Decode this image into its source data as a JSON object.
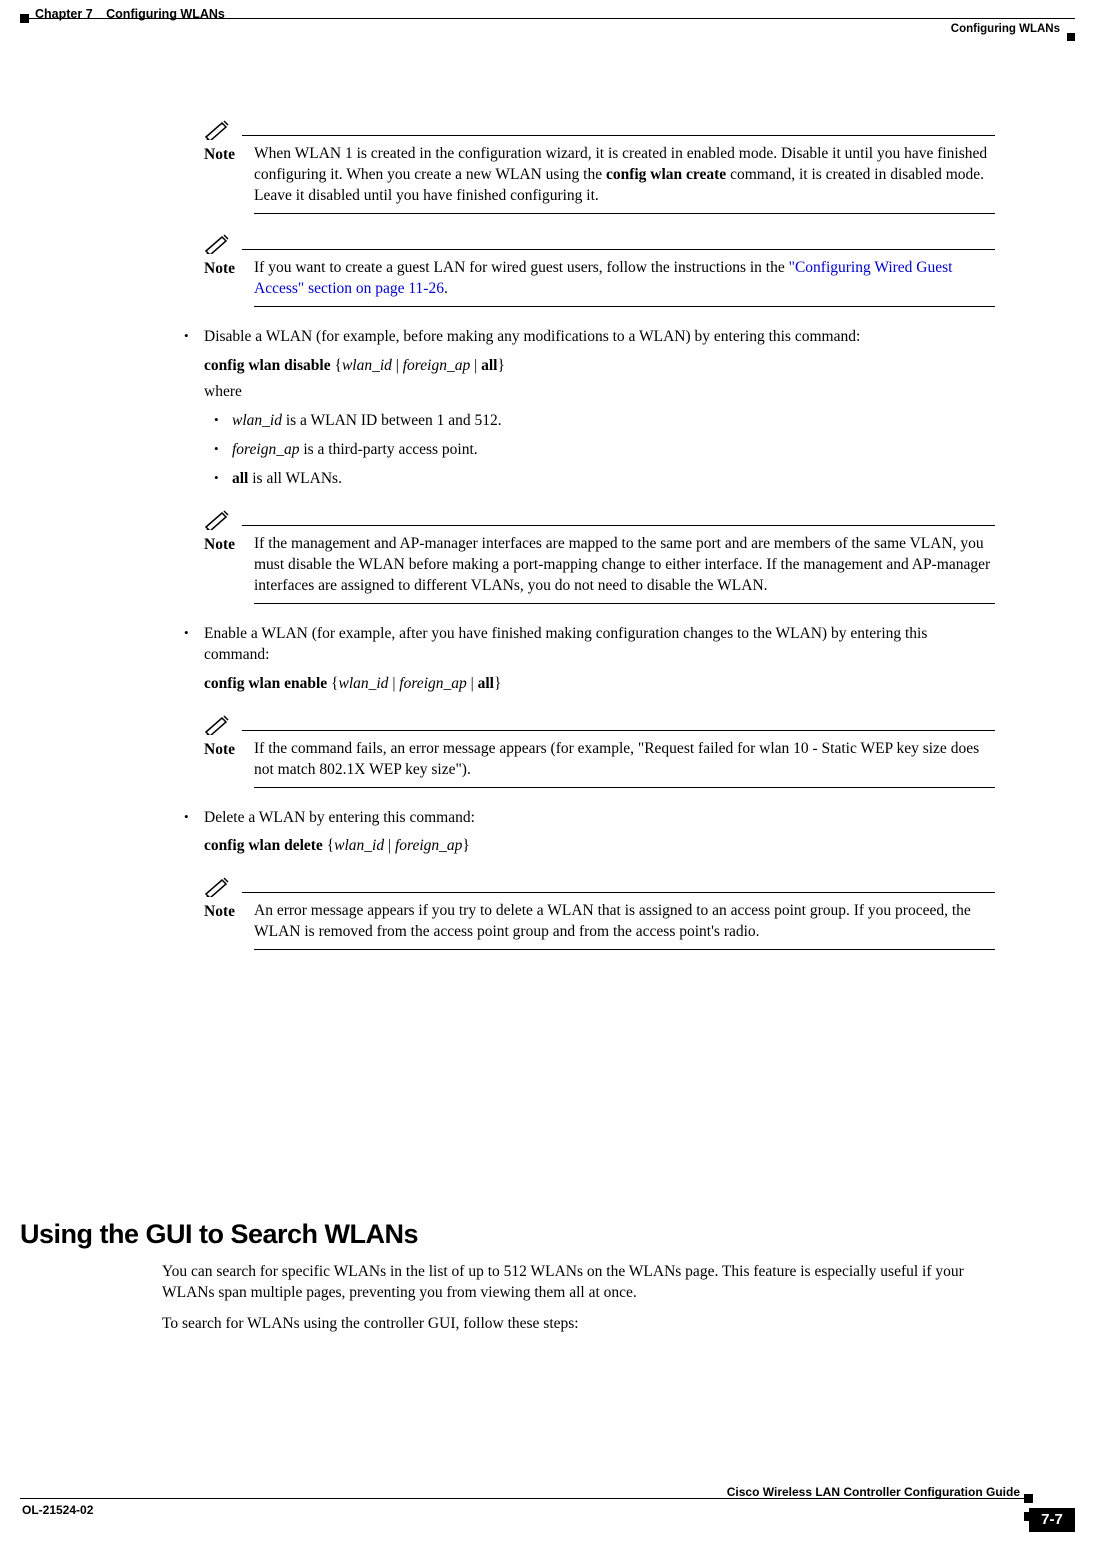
{
  "header": {
    "chapter_left": "Chapter 7",
    "chapter_title": "Configuring WLANs",
    "section_right": "Configuring WLANs"
  },
  "note_label": "Note",
  "notes": {
    "n1": "When WLAN 1 is created in the configuration wizard, it is created in enabled mode. Disable it until you have finished configuring it. When you create a new WLAN using the ",
    "n1_bold1": "config wlan create",
    "n1_after": " command, it is created in disabled mode. Leave it disabled until you have finished configuring it.",
    "n2_a": "If you want to create a guest LAN for wired guest users, follow the instructions in the ",
    "n2_link": "\"Configuring Wired Guest Access\" section on page 11-26",
    "n2_b": ".",
    "n3": "If the management and AP-manager interfaces are mapped to the same port and are members of the same VLAN, you must disable the WLAN before making a port-mapping change to either interface. If the management and AP-manager interfaces are assigned to different VLANs, you do not need to disable the WLAN.",
    "n4": "If the command fails, an error message appears (for example, \"Request failed for wlan 10 - Static WEP key size does not match 802.1X WEP key size\").",
    "n5": "An error message appears if you try to delete a WLAN that is assigned to an access point group. If you proceed, the WLAN is removed from the access point group and from the access point's radio."
  },
  "bullets": {
    "disable_intro": "Disable a WLAN (for example, before making any modifications to a WLAN) by entering this command:",
    "disable_cmd_bold": "config wlan disable",
    "disable_cmd_args_open": " {",
    "disable_cmd_arg1": "wlan_id",
    "disable_cmd_pipe1": " | ",
    "disable_cmd_arg2": "foreign_ap",
    "disable_cmd_pipe2": " | ",
    "disable_cmd_arg3": "all",
    "disable_cmd_close": "}",
    "where": "where",
    "sub1_i": "wlan_id",
    "sub1_t": " is a WLAN ID between 1 and 512.",
    "sub2_i": "foreign_ap",
    "sub2_t": " is a third-party access point.",
    "sub3_b": "all",
    "sub3_t": " is all WLANs.",
    "enable_intro": "Enable a WLAN (for example, after you have finished making configuration changes to the WLAN) by entering this command:",
    "enable_cmd_bold": "config wlan enable",
    "enable_cmd_args_open": " {",
    "enable_cmd_arg1": "wlan_id",
    "enable_cmd_pipe1": " | ",
    "enable_cmd_arg2": "foreign_ap",
    "enable_cmd_pipe2": " | ",
    "enable_cmd_arg3": "all",
    "enable_cmd_close": "}",
    "delete_intro": "Delete a WLAN by entering this command:",
    "delete_cmd_bold": "config wlan delete",
    "delete_cmd_args_open": " {",
    "delete_cmd_arg1": "wlan_id",
    "delete_cmd_pipe1": " | ",
    "delete_cmd_arg2": "foreign_ap",
    "delete_cmd_close": "}"
  },
  "section": {
    "heading": "Using the GUI to Search WLANs",
    "p1": "You can search for specific WLANs in the list of up to 512 WLANs on the WLANs page. This feature is especially useful if your WLANs span multiple pages, preventing you from viewing them all at once.",
    "p2": "To search for WLANs using the controller GUI, follow these steps:"
  },
  "footer": {
    "doc": "Cisco Wireless LAN Controller Configuration Guide",
    "ol": "OL-21524-02",
    "pagenum": "7-7"
  }
}
